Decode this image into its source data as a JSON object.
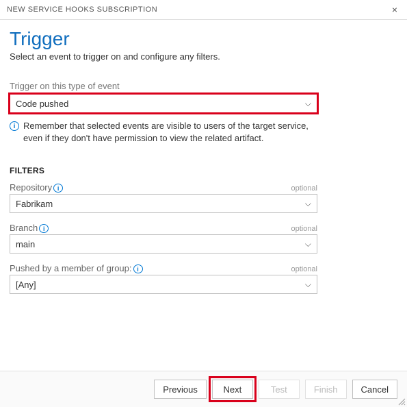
{
  "titlebar": {
    "title": "NEW SERVICE HOOKS SUBSCRIPTION"
  },
  "header": {
    "title": "Trigger",
    "subtitle": "Select an event to trigger on and configure any filters."
  },
  "event": {
    "label": "Trigger on this type of event",
    "value": "Code pushed",
    "info": "Remember that selected events are visible to users of the target service, even if they don't have permission to view the related artifact."
  },
  "filters": {
    "heading": "FILTERS",
    "optional_text": "optional",
    "items": [
      {
        "label": "Repository",
        "value": "Fabrikam",
        "has_info": true
      },
      {
        "label": "Branch",
        "value": "main",
        "has_info": true
      },
      {
        "label": "Pushed by a member of group:",
        "value": "[Any]",
        "has_info": true
      }
    ]
  },
  "footer": {
    "previous": "Previous",
    "next": "Next",
    "test": "Test",
    "finish": "Finish",
    "cancel": "Cancel"
  }
}
